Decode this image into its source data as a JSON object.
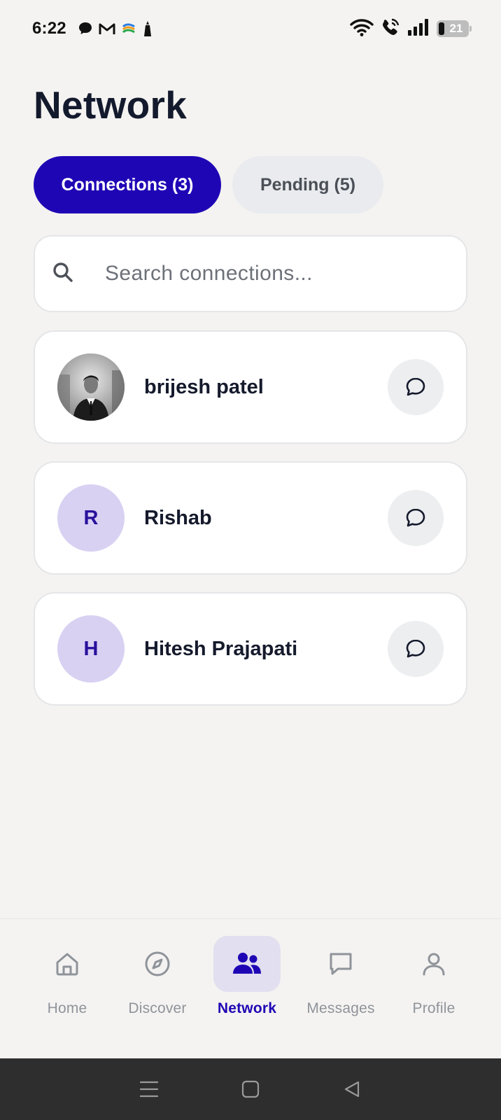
{
  "status_bar": {
    "time": "6:22",
    "battery_level": "21",
    "left_icons": [
      "chat-bubble-icon",
      "gmail-icon",
      "app-icon",
      "person-icon"
    ],
    "right_icons": [
      "wifi-icon",
      "wifi-call-icon",
      "signal-icon",
      "battery-icon"
    ]
  },
  "page": {
    "title": "Network"
  },
  "tabs": [
    {
      "label": "Connections (3)",
      "active": true
    },
    {
      "label": "Pending (5)",
      "active": false
    }
  ],
  "search": {
    "placeholder": "Search connections...",
    "value": ""
  },
  "connections": [
    {
      "name": "brijesh patel",
      "avatar_type": "photo",
      "initial": ""
    },
    {
      "name": "Rishab",
      "avatar_type": "initial",
      "initial": "R"
    },
    {
      "name": "Hitesh Prajapati",
      "avatar_type": "initial",
      "initial": "H"
    }
  ],
  "bottom_nav": {
    "items": [
      {
        "label": "Home",
        "icon": "home-icon",
        "active": false
      },
      {
        "label": "Discover",
        "icon": "compass-icon",
        "active": false
      },
      {
        "label": "Network",
        "icon": "people-icon",
        "active": true
      },
      {
        "label": "Messages",
        "icon": "chat-icon",
        "active": false
      },
      {
        "label": "Profile",
        "icon": "user-icon",
        "active": false
      }
    ]
  },
  "system_nav": {
    "buttons": [
      "menu-icon",
      "home-square-icon",
      "back-triangle-icon"
    ]
  },
  "colors": {
    "accent": "#1f06b5",
    "background": "#f4f3f1",
    "avatar_bg": "#d8d1f2",
    "inactive_tab": "#e9ebee"
  }
}
